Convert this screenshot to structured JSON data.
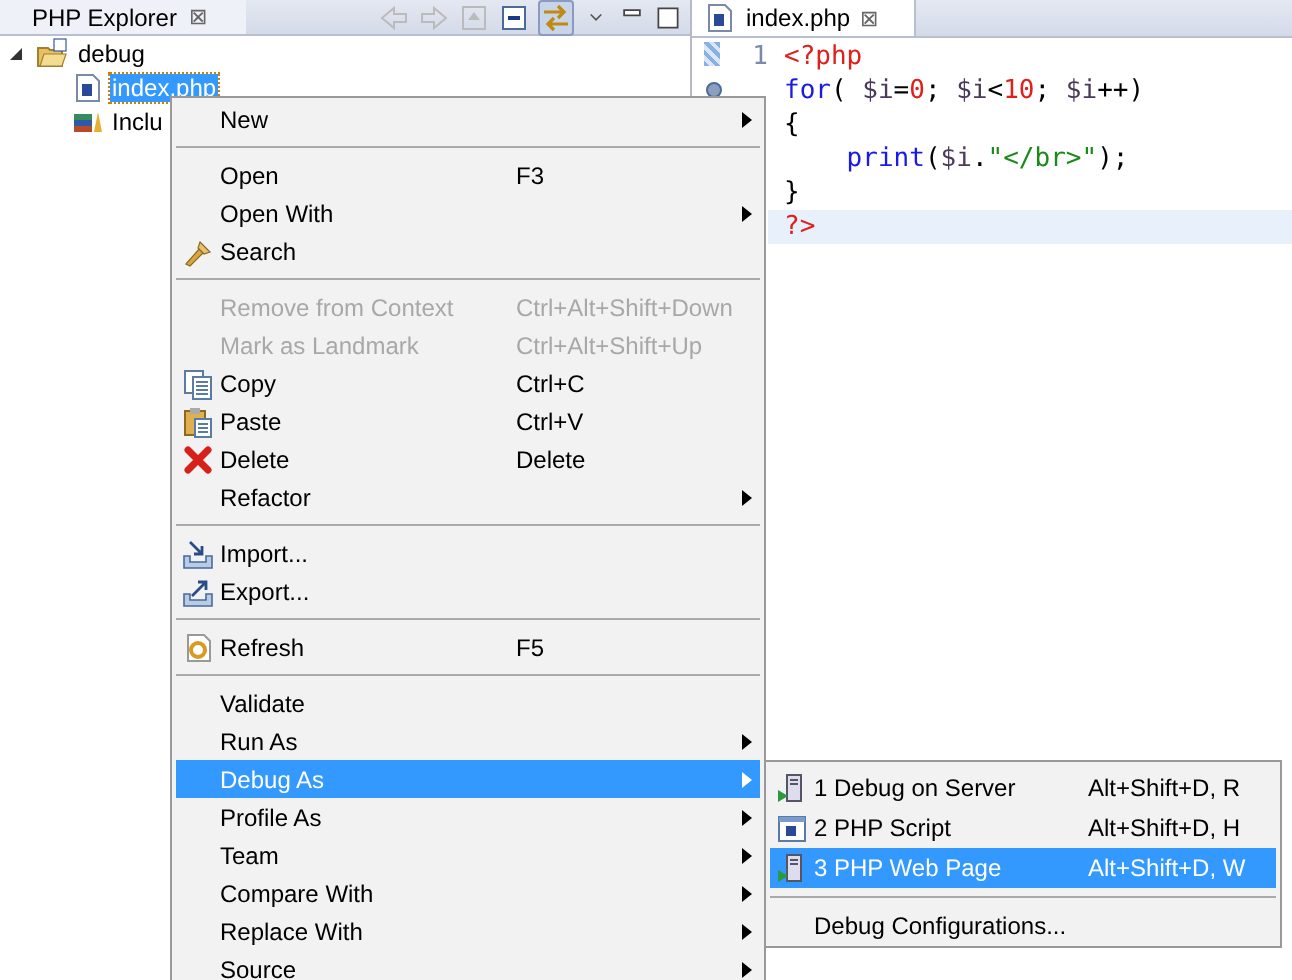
{
  "explorer": {
    "title": "PHP Explorer",
    "close": "⊠",
    "tree": [
      {
        "label": "debug",
        "expanded": true,
        "selected": false,
        "children": [
          {
            "label": "index.php",
            "selected": true
          },
          {
            "label": "Inclu",
            "selected": false
          }
        ]
      }
    ]
  },
  "editor": {
    "tab": "index.php",
    "close": "⊠",
    "line_numbers": [
      "1"
    ],
    "lines": [
      {
        "current": false,
        "tokens": [
          {
            "kind": "tag",
            "text": "<?php"
          }
        ]
      },
      {
        "current": false,
        "tokens": [
          {
            "kind": "keyword",
            "text": "for"
          },
          {
            "kind": "plain",
            "text": "( "
          },
          {
            "kind": "var",
            "text": "$i"
          },
          {
            "kind": "plain",
            "text": "="
          },
          {
            "kind": "number",
            "text": "0"
          },
          {
            "kind": "plain",
            "text": "; "
          },
          {
            "kind": "var",
            "text": "$i"
          },
          {
            "kind": "plain",
            "text": "<"
          },
          {
            "kind": "number",
            "text": "10"
          },
          {
            "kind": "plain",
            "text": "; "
          },
          {
            "kind": "var",
            "text": "$i"
          },
          {
            "kind": "plain",
            "text": "++)"
          }
        ]
      },
      {
        "current": false,
        "tokens": [
          {
            "kind": "plain",
            "text": "{"
          }
        ]
      },
      {
        "current": false,
        "tokens": [
          {
            "kind": "keyword",
            "text": "    print"
          },
          {
            "kind": "plain",
            "text": "("
          },
          {
            "kind": "var",
            "text": "$i"
          },
          {
            "kind": "plain",
            "text": "."
          },
          {
            "kind": "string",
            "text": "\"</br>\""
          },
          {
            "kind": "plain",
            "text": ");"
          }
        ]
      },
      {
        "current": false,
        "tokens": [
          {
            "kind": "plain",
            "text": "}"
          }
        ]
      },
      {
        "current": true,
        "tokens": [
          {
            "kind": "tag",
            "text": "?>"
          }
        ]
      }
    ]
  },
  "context_menu": {
    "items": [
      {
        "kind": "item",
        "label": "New",
        "submenu": true,
        "disabled": false,
        "selected": false
      },
      {
        "kind": "separator"
      },
      {
        "kind": "item",
        "label": "Open",
        "shortcut": "F3",
        "submenu": false,
        "disabled": false,
        "selected": false
      },
      {
        "kind": "item",
        "label": "Open With",
        "submenu": true,
        "disabled": false,
        "selected": false
      },
      {
        "kind": "item",
        "label": "Search",
        "submenu": false,
        "disabled": false,
        "selected": false
      },
      {
        "kind": "separator"
      },
      {
        "kind": "item",
        "label": "Remove from Context",
        "shortcut": "Ctrl+Alt+Shift+Down",
        "submenu": false,
        "disabled": true,
        "selected": false
      },
      {
        "kind": "item",
        "label": "Mark as Landmark",
        "shortcut": "Ctrl+Alt+Shift+Up",
        "submenu": false,
        "disabled": true,
        "selected": false
      },
      {
        "kind": "item",
        "label": "Copy",
        "shortcut": "Ctrl+C",
        "submenu": false,
        "disabled": false,
        "selected": false
      },
      {
        "kind": "item",
        "label": "Paste",
        "shortcut": "Ctrl+V",
        "submenu": false,
        "disabled": false,
        "selected": false
      },
      {
        "kind": "item",
        "label": "Delete",
        "shortcut": "Delete",
        "submenu": false,
        "disabled": false,
        "selected": false
      },
      {
        "kind": "item",
        "label": "Refactor",
        "submenu": true,
        "disabled": false,
        "selected": false
      },
      {
        "kind": "separator"
      },
      {
        "kind": "item",
        "label": "Import...",
        "submenu": false,
        "disabled": false,
        "selected": false
      },
      {
        "kind": "item",
        "label": "Export...",
        "submenu": false,
        "disabled": false,
        "selected": false
      },
      {
        "kind": "separator"
      },
      {
        "kind": "item",
        "label": "Refresh",
        "shortcut": "F5",
        "submenu": false,
        "disabled": false,
        "selected": false
      },
      {
        "kind": "separator"
      },
      {
        "kind": "item",
        "label": "Validate",
        "submenu": false,
        "disabled": false,
        "selected": false
      },
      {
        "kind": "item",
        "label": "Run As",
        "submenu": true,
        "disabled": false,
        "selected": false
      },
      {
        "kind": "item",
        "label": "Debug As",
        "submenu": true,
        "disabled": false,
        "selected": true
      },
      {
        "kind": "item",
        "label": "Profile As",
        "submenu": true,
        "disabled": false,
        "selected": false
      },
      {
        "kind": "item",
        "label": "Team",
        "submenu": true,
        "disabled": false,
        "selected": false
      },
      {
        "kind": "item",
        "label": "Compare With",
        "submenu": true,
        "disabled": false,
        "selected": false
      },
      {
        "kind": "item",
        "label": "Replace With",
        "submenu": true,
        "disabled": false,
        "selected": false
      },
      {
        "kind": "item",
        "label": "Source",
        "submenu": true,
        "disabled": false,
        "selected": false
      }
    ]
  },
  "submenu": {
    "items": [
      {
        "kind": "item",
        "label": "1 Debug on Server",
        "shortcut": "Alt+Shift+D, R",
        "selected": false
      },
      {
        "kind": "item",
        "label": "2 PHP Script",
        "shortcut": "Alt+Shift+D, H",
        "selected": false
      },
      {
        "kind": "item",
        "label": "3 PHP Web Page",
        "shortcut": "Alt+Shift+D, W",
        "selected": true
      },
      {
        "kind": "separator"
      },
      {
        "kind": "item",
        "label": "Debug Configurations...",
        "selected": false
      }
    ]
  }
}
